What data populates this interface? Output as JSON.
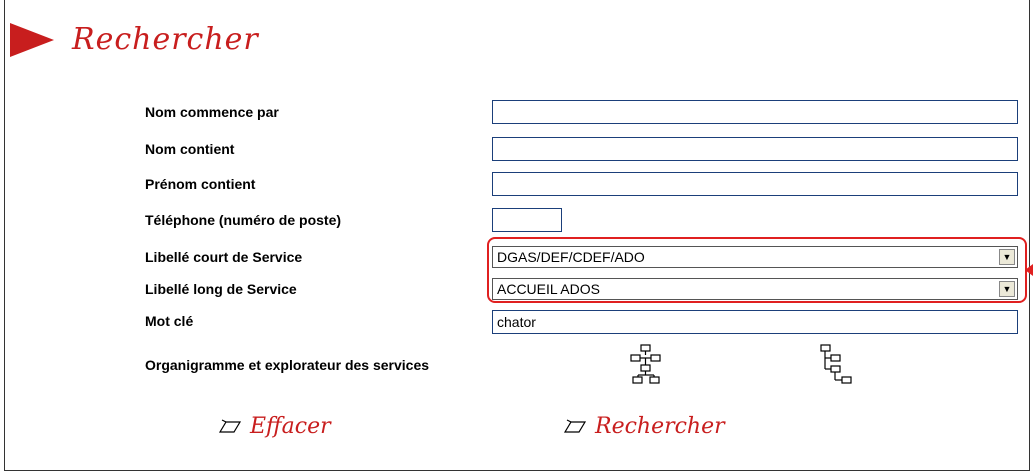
{
  "header": {
    "title": "Rechercher"
  },
  "form": {
    "nom_commence": {
      "label": "Nom commence par",
      "value": ""
    },
    "nom_contient": {
      "label": "Nom contient",
      "value": ""
    },
    "prenom_contient": {
      "label": "Prénom contient",
      "value": ""
    },
    "telephone": {
      "label": "Téléphone (numéro de poste)",
      "value": ""
    },
    "libelle_court": {
      "label": "Libellé court de Service",
      "selected": "DGAS/DEF/CDEF/ADO"
    },
    "libelle_long": {
      "label": "Libellé long de Service",
      "selected": "ACCUEIL ADOS"
    },
    "mot_cle": {
      "label": "Mot clé",
      "value": "chator"
    },
    "organigramme": {
      "label": "Organigramme et explorateur des services"
    }
  },
  "actions": {
    "effacer": "Effacer",
    "rechercher": "Rechercher"
  },
  "icons": {
    "org_chart": "org-chart-icon",
    "tree_explorer": "tree-explorer-icon",
    "pencil": "pencil-icon"
  },
  "colors": {
    "accent": "#c81e1e",
    "highlight": "#e02020",
    "field_border": "#1b3f7a"
  }
}
